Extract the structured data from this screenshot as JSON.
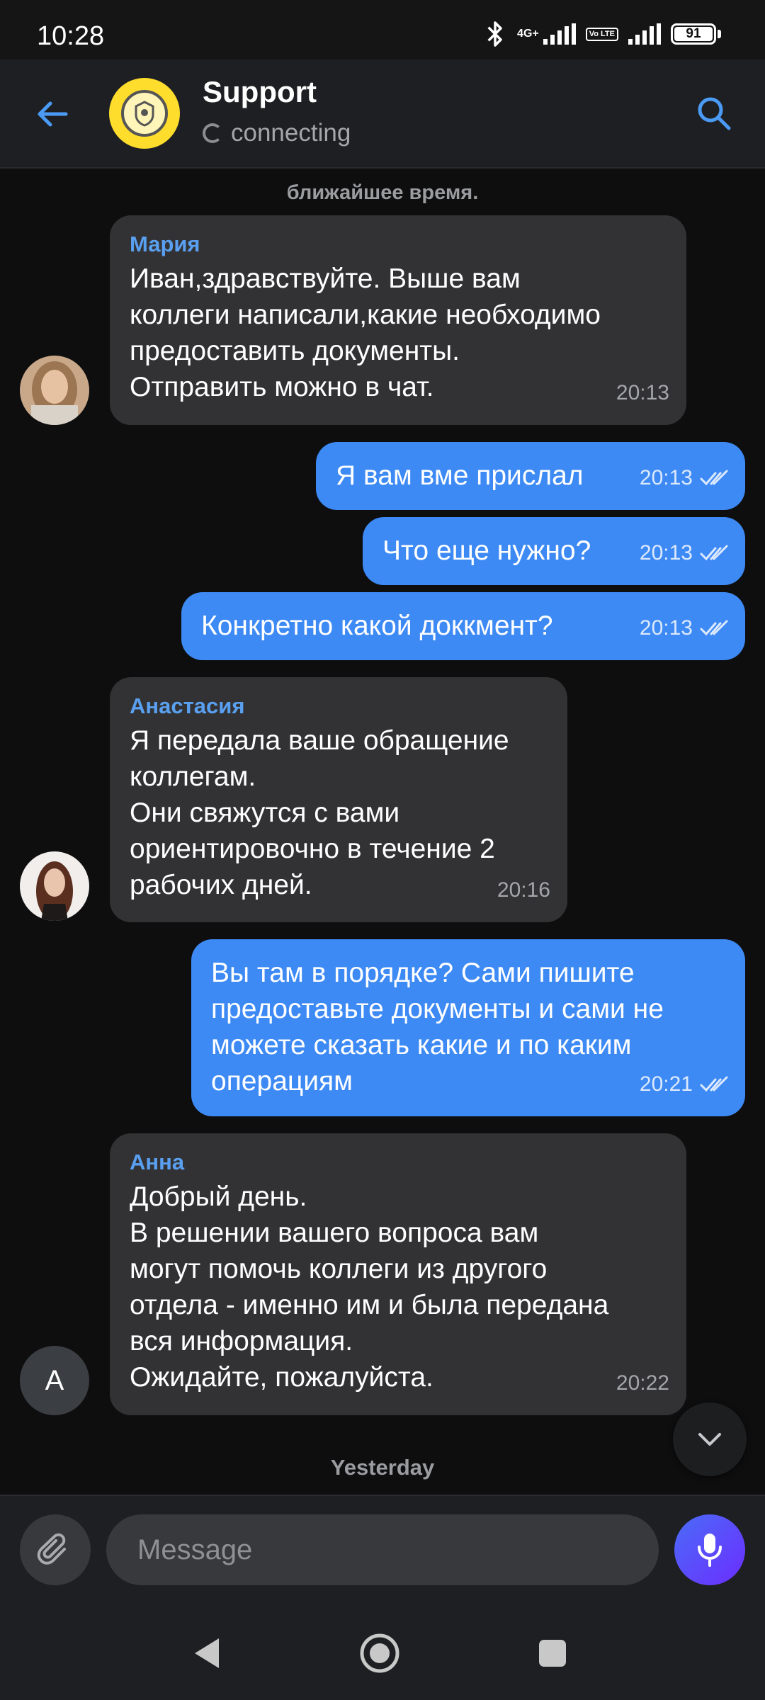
{
  "status_bar": {
    "time": "10:28",
    "network": "4G+",
    "volte": "Vo LTE",
    "battery": "91"
  },
  "header": {
    "title": "Support",
    "status": "connecting"
  },
  "chat": {
    "partial_system_text": "ближайшее время.",
    "messages": [
      {
        "sender": "Мария",
        "text": "Иван,здравствуйте. Выше вам\nколлеги написали,какие необходимо\nпредоставить документы.\nОтправить можно в чат.",
        "time": "20:13"
      },
      {
        "text": "Я вам вме прислал",
        "time": "20:13"
      },
      {
        "text": "Что еще нужно?",
        "time": "20:13"
      },
      {
        "text": "Конкретно какой доккмент?",
        "time": "20:13"
      },
      {
        "sender": "Анастасия",
        "text": "Я передала ваше обращение\nколлегам.\nОни свяжутся с вами\nориентировочно в течение 2\nрабочих дней.",
        "time": "20:16"
      },
      {
        "text": "Вы там в порядке? Сами пишите\nпредоставьте документы и сами не\nможете сказать какие и по каким\nоперациям",
        "time": "20:21"
      },
      {
        "sender": "Анна",
        "text": "Добрый день.\nВ решении вашего вопроса вам\nмогут помочь коллеги из другого\nотдела - именно им и была передана\nвся информация.\nОжидайте, пожалуйста.",
        "time": "20:22",
        "avatar_letter": "A"
      }
    ],
    "date_separator": "Yesterday"
  },
  "input": {
    "placeholder": "Message"
  },
  "colors": {
    "accent": "#3d8af5",
    "incoming_bubble": "#323235",
    "sender_name": "#5aa0f0",
    "background": "#0e0e0f"
  }
}
